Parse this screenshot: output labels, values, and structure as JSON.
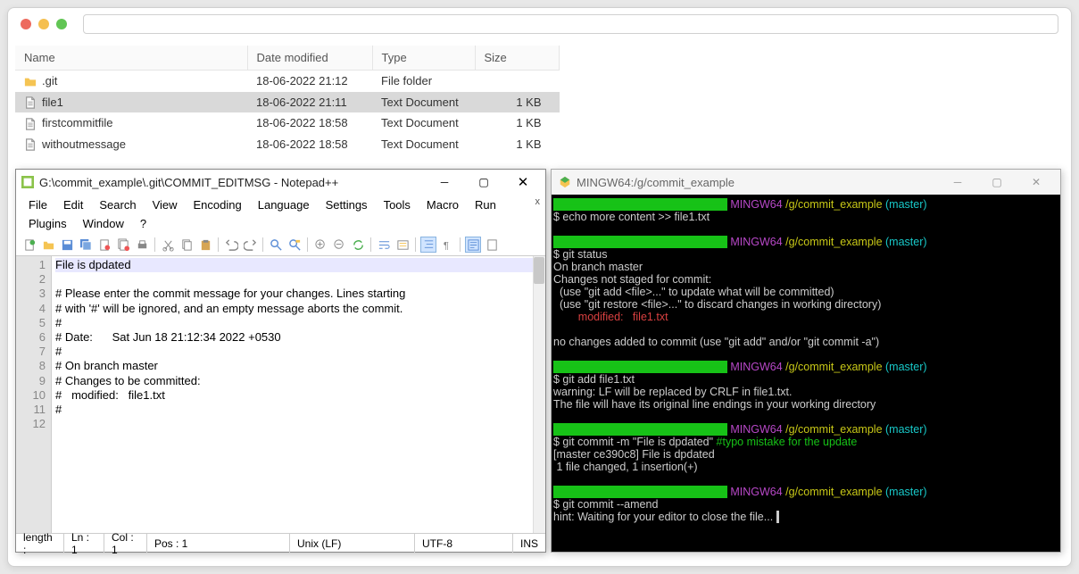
{
  "explorer": {
    "cols": [
      "Name",
      "Date modified",
      "Type",
      "Size"
    ],
    "rows": [
      {
        "icon": "folder",
        "name": ".git",
        "date": "18-06-2022 21:12",
        "type": "File folder",
        "size": "",
        "sel": false
      },
      {
        "icon": "file",
        "name": "file1",
        "date": "18-06-2022 21:11",
        "type": "Text Document",
        "size": "1 KB",
        "sel": true
      },
      {
        "icon": "file",
        "name": "firstcommitfile",
        "date": "18-06-2022 18:58",
        "type": "Text Document",
        "size": "1 KB",
        "sel": false
      },
      {
        "icon": "file",
        "name": "withoutmessage",
        "date": "18-06-2022 18:58",
        "type": "Text Document",
        "size": "1 KB",
        "sel": false
      }
    ]
  },
  "notepad": {
    "title": "G:\\commit_example\\.git\\COMMIT_EDITMSG - Notepad++",
    "menu": [
      "File",
      "Edit",
      "Search",
      "View",
      "Encoding",
      "Language",
      "Settings",
      "Tools",
      "Macro",
      "Run",
      "Plugins",
      "Window",
      "?"
    ],
    "lines": [
      "File is dpdated",
      "",
      "# Please enter the commit message for your changes. Lines starting",
      "# with '#' will be ignored, and an empty message aborts the commit.",
      "#",
      "# Date:      Sat Jun 18 21:12:34 2022 +0530",
      "#",
      "# On branch master",
      "# Changes to be committed:",
      "#   modified:   file1.txt",
      "#",
      ""
    ],
    "status": {
      "len": "length :",
      "ln": "Ln : 1",
      "col": "Col : 1",
      "pos": "Pos : 1",
      "eol": "Unix (LF)",
      "enc": "UTF-8",
      "mode": "INS"
    }
  },
  "terminal": {
    "title": "MINGW64:/g/commit_example"
  }
}
